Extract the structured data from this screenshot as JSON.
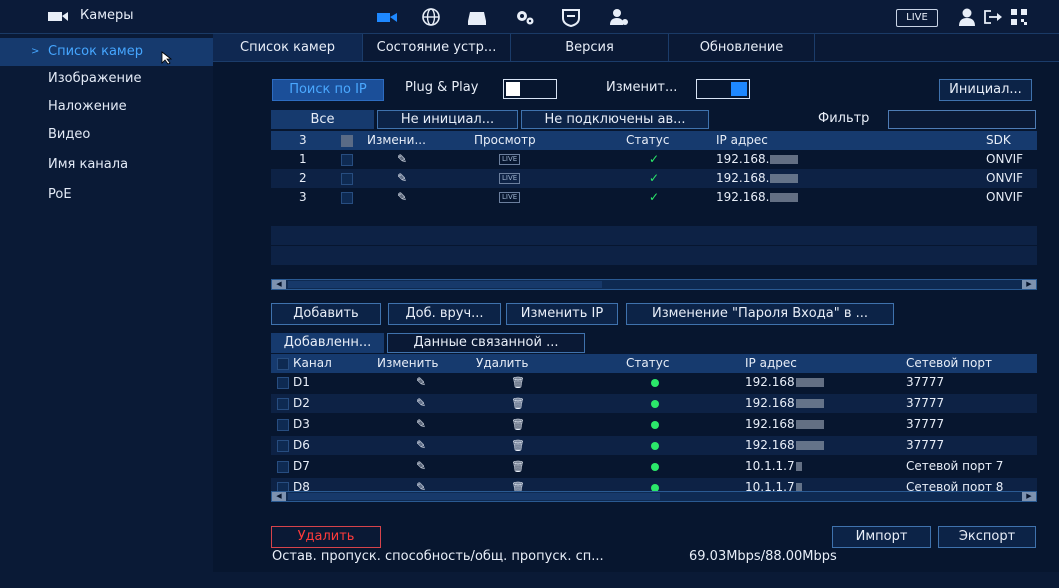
{
  "topbar": {
    "title": "Камеры",
    "live_label": "LIVE",
    "icons": [
      "camera-icon",
      "network-icon",
      "storage-icon",
      "system-icon",
      "security-icon",
      "account-icon"
    ],
    "right_icons": [
      "user-icon",
      "logout-icon",
      "qr-icon"
    ]
  },
  "sidebar": {
    "items": [
      {
        "label": "Список камер",
        "active": true
      },
      {
        "label": "Изображение"
      },
      {
        "label": "Наложение"
      },
      {
        "label": "Видео"
      },
      {
        "label": "Имя канала"
      },
      {
        "label": "PoE"
      }
    ]
  },
  "tabs": [
    "Список камер",
    "Состояние устр...",
    "Версия",
    "Обновление"
  ],
  "search": {
    "search_ip": "Поиск по IP",
    "plug_play": "Plug & Play",
    "modify": "Изменит...",
    "init": "Инициал..."
  },
  "filter_tabs": [
    "Все",
    "Не инициал...",
    "Не подключены ав..."
  ],
  "filter_label": "Фильтр",
  "found_table": {
    "headers": [
      "3",
      "Измени...",
      "Просмотр",
      "Статус",
      "IP адрес",
      "SDK"
    ],
    "rows": [
      {
        "num": "1",
        "live": "LIVE",
        "ip": "192.168.",
        "sdk": "ONVIF"
      },
      {
        "num": "2",
        "live": "LIVE",
        "ip": "192.168.",
        "sdk": "ONVIF"
      },
      {
        "num": "3",
        "live": "LIVE",
        "ip": "192.168.",
        "sdk": "ONVIF"
      }
    ]
  },
  "actions": {
    "add": "Добавить",
    "add_manual": "Доб. вруч...",
    "change_ip": "Изменить IP",
    "change_password": "Изменение \"Пароля Входа\" в ..."
  },
  "added_tabs": [
    "Добавленн...",
    "Данные связанной ..."
  ],
  "added_table": {
    "headers": [
      "Канал",
      "Изменить",
      "Удалить",
      "Статус",
      "IP адрес",
      "Сетевой порт"
    ],
    "rows": [
      {
        "channel": "D1",
        "ip": "192.168",
        "port": "37777"
      },
      {
        "channel": "D2",
        "ip": "192.168",
        "port": "37777"
      },
      {
        "channel": "D3",
        "ip": "192.168",
        "port": "37777"
      },
      {
        "channel": "D6",
        "ip": "192.168",
        "port": "37777"
      },
      {
        "channel": "D7",
        "ip": "10.1.1.7",
        "port": "Сетевой порт 7"
      },
      {
        "channel": "D8",
        "ip": "10.1.1.7",
        "port": "Сетевой порт 8"
      }
    ]
  },
  "bottom": {
    "delete": "Удалить",
    "import": "Импорт",
    "export": "Экспорт",
    "bandwidth_label": "Остав. пропуск. способность/общ. пропуск. сп...",
    "bandwidth_value": "69.03Mbps/88.00Mbps"
  },
  "colors": {
    "accent": "#1e88ff",
    "status_ok": "#2be86a",
    "danger": "#ff3b3b"
  }
}
